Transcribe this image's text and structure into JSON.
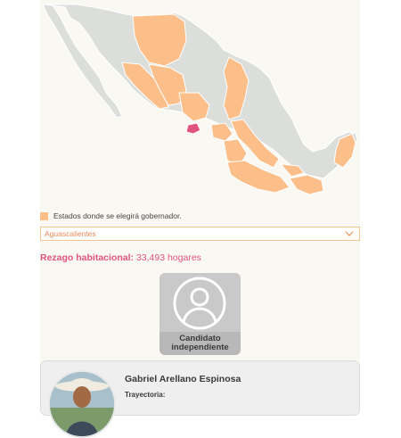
{
  "legend": {
    "label": "Estados donde se elegirá gobernador.",
    "swatch_color": "#fcbf8a"
  },
  "state_select": {
    "selected": "Aguascalientes",
    "icon": "chevron-down-icon"
  },
  "rezago": {
    "label": "Rezago habitacional:",
    "value": "33,493 hogares"
  },
  "candidate_card": {
    "line1": "Candidato",
    "line2": "independiente",
    "icon": "person-silhouette-icon"
  },
  "person": {
    "name": "Gabriel Arellano Espinosa",
    "trayectoria_label": "Trayectoria:"
  },
  "colors": {
    "highlight_state": "#e0547f",
    "election_state": "#fcbf8a",
    "other_state": "#dcdedc",
    "accent": "#e0547f"
  }
}
